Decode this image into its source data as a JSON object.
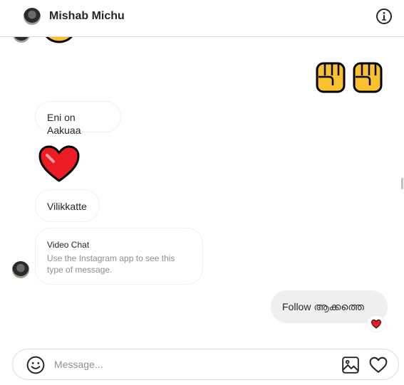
{
  "header": {
    "username": "Mishab Michu",
    "avatar_icon": "user-avatar",
    "info_icon": "info-icon"
  },
  "messages": {
    "received_1": "Eni on Aakuaa",
    "received_2": "Vilikkatte",
    "video_chat": {
      "title": "Video Chat",
      "subtitle": "Use the Instagram app to see this type of message."
    },
    "sent_1": "Follow ആക്കത്തെ"
  },
  "emoji": {
    "partial_top": "face-emoji",
    "sent_fists": [
      "raised-fist-emoji",
      "raised-fist-emoji"
    ],
    "received_heart": "red-heart-emoji",
    "reaction": "red-heart-emoji"
  },
  "composer": {
    "placeholder": "Message...",
    "value": ""
  },
  "colors": {
    "border": "#dbdbdb",
    "sent_bubble": "#efefef",
    "heart": "#ed1c24",
    "fist": "#f8c12d"
  }
}
